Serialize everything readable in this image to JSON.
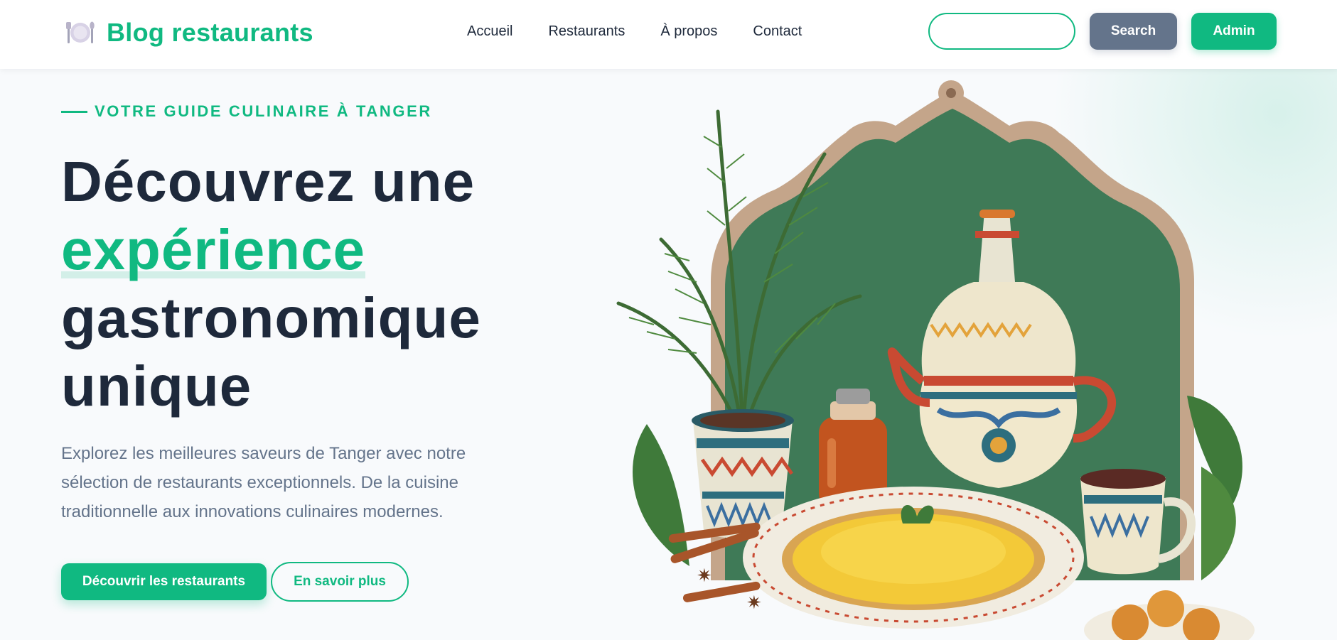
{
  "header": {
    "brand_name": "Blog restaurants",
    "brand_icon": "plate-cutlery-icon",
    "nav": [
      "Accueil",
      "Restaurants",
      "À propos",
      "Contact"
    ],
    "search_placeholder": "",
    "search_button": "Search",
    "admin_button": "Admin"
  },
  "hero": {
    "eyebrow": "VOTRE GUIDE CULINAIRE À TANGER",
    "title_line1": "Découvrez une",
    "title_accent": "expérience",
    "title_line3": "gastronomique",
    "title_line4": "unique",
    "description": "Explorez les meilleures saveurs de Tanger avec notre sélection de restaurants exceptionnels. De la cuisine traditionnelle aux innovations culinaires modernes.",
    "cta_primary": "Découvrir les restaurants",
    "cta_secondary": "En savoir plus",
    "illustration": "moroccan-tea-couscous-illustration"
  },
  "colors": {
    "accent": "#10b981",
    "text_dark": "#1e293b",
    "text_muted": "#64748b",
    "search_button": "#64748b",
    "background": "#f8fafc"
  }
}
